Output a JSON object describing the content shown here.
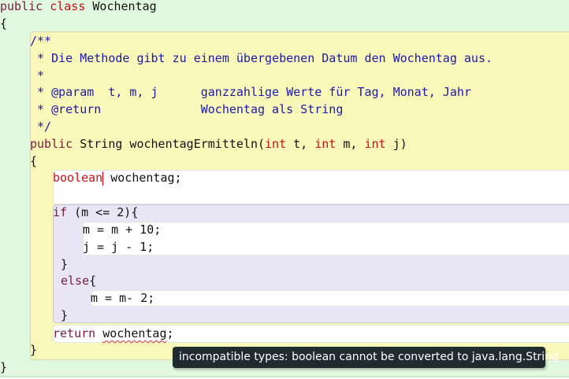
{
  "editor": {
    "class_decl": {
      "kw_public": "public",
      "kw_class": "class",
      "name": "Wochentag"
    },
    "brace_open": "{",
    "brace_close": "}",
    "javadoc": [
      "/**",
      " * Die Methode gibt zu einem übergebenen Datum den Wochentag aus.",
      " *",
      " * @param  t, m, j      ganzzahlige Werte für Tag, Monat, Jahr",
      " * @return              Wochentag als String",
      " */"
    ],
    "method_sig": {
      "kw_public": "public",
      "rest1": " String wochentagErmitteln(",
      "int1": "int",
      " p1": " t, ",
      "int2": "int",
      "p2": " m, ",
      "int3": "int",
      "p3": " j)"
    },
    "decl": {
      "type": "boolean",
      "rest": " wochentag;"
    },
    "if_line": {
      "kw": "if",
      "rest": " (m <= 2){"
    },
    "if_body": [
      "m = m + 10;",
      "j = j - 1;"
    ],
    "else_line": {
      "kw": "else",
      "rest": "{"
    },
    "else_body": "m = m- 2;",
    "return_line": {
      "kw": "return",
      "space": " ",
      "var": "wochentag",
      "semi": ";"
    }
  },
  "tooltip": {
    "error_message": "incompatible types: boolean cannot be converted to java.lang.String"
  },
  "colors": {
    "class_scope": "#e0f8df",
    "method_scope": "#faf8b8",
    "if_scope": "#e8e6f4",
    "keyword": "#7a1a3d",
    "type_keyword": "#cc1111",
    "comment": "#1a1aa8",
    "tooltip_bg": "#1f2b2e"
  }
}
